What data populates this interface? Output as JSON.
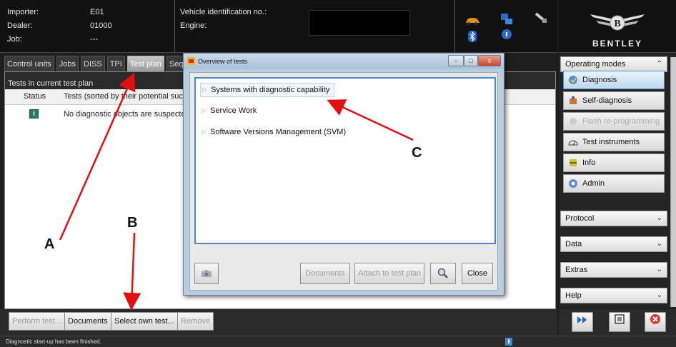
{
  "header": {
    "importer_label": "Importer:",
    "importer_value": "E01",
    "dealer_label": "Dealer:",
    "dealer_value": "01000",
    "job_label": "Job:",
    "job_value": "---",
    "vin_label": "Vehicle identification no.:",
    "engine_label": "Engine:",
    "icons": [
      "car-icon",
      "computer-icon",
      "diag-plug-icon",
      "bluetooth-icon",
      "info-bubble-icon"
    ]
  },
  "logo": {
    "brand": "BENTLEY"
  },
  "tabs": [
    {
      "label": "Control units"
    },
    {
      "label": "Jobs"
    },
    {
      "label": "DISS"
    },
    {
      "label": "TPI"
    },
    {
      "label": "Test plan"
    },
    {
      "label": "Seque"
    }
  ],
  "main": {
    "title": "Tests in current test plan",
    "columns": {
      "status": "Status",
      "tests": "Tests (sorted by their potential suc"
    },
    "row_text": "No diagnostic objects are suspecte"
  },
  "buttons": {
    "perform": "Perform test...",
    "documents": "Documents",
    "select_own": "Select own test...",
    "remove": "Remove"
  },
  "status_text": "Diagnostic start-up has been finished.",
  "right_panel": {
    "operating_modes": "Operating modes",
    "modes": [
      {
        "label": "Diagnosis",
        "selected": true
      },
      {
        "label": "Self-diagnosis"
      },
      {
        "label": "Flash re-programming",
        "disabled": true
      },
      {
        "label": "Test instruments"
      },
      {
        "label": "Info"
      },
      {
        "label": "Admin"
      }
    ],
    "protocol": "Protocol",
    "data": "Data",
    "extras": "Extras",
    "help": "Help"
  },
  "dialog": {
    "title": "Overview of tests",
    "items": [
      "Systems with diagnostic capability",
      "Service Work",
      "Software Versions Management (SVM)"
    ],
    "documents": "Documents",
    "attach": "Attach to test plan",
    "close": "Close"
  },
  "annotations": {
    "a": "A",
    "b": "B",
    "c": "C"
  },
  "colors": {
    "arrow": "#e01010",
    "selected_border": "#4d85c6"
  }
}
